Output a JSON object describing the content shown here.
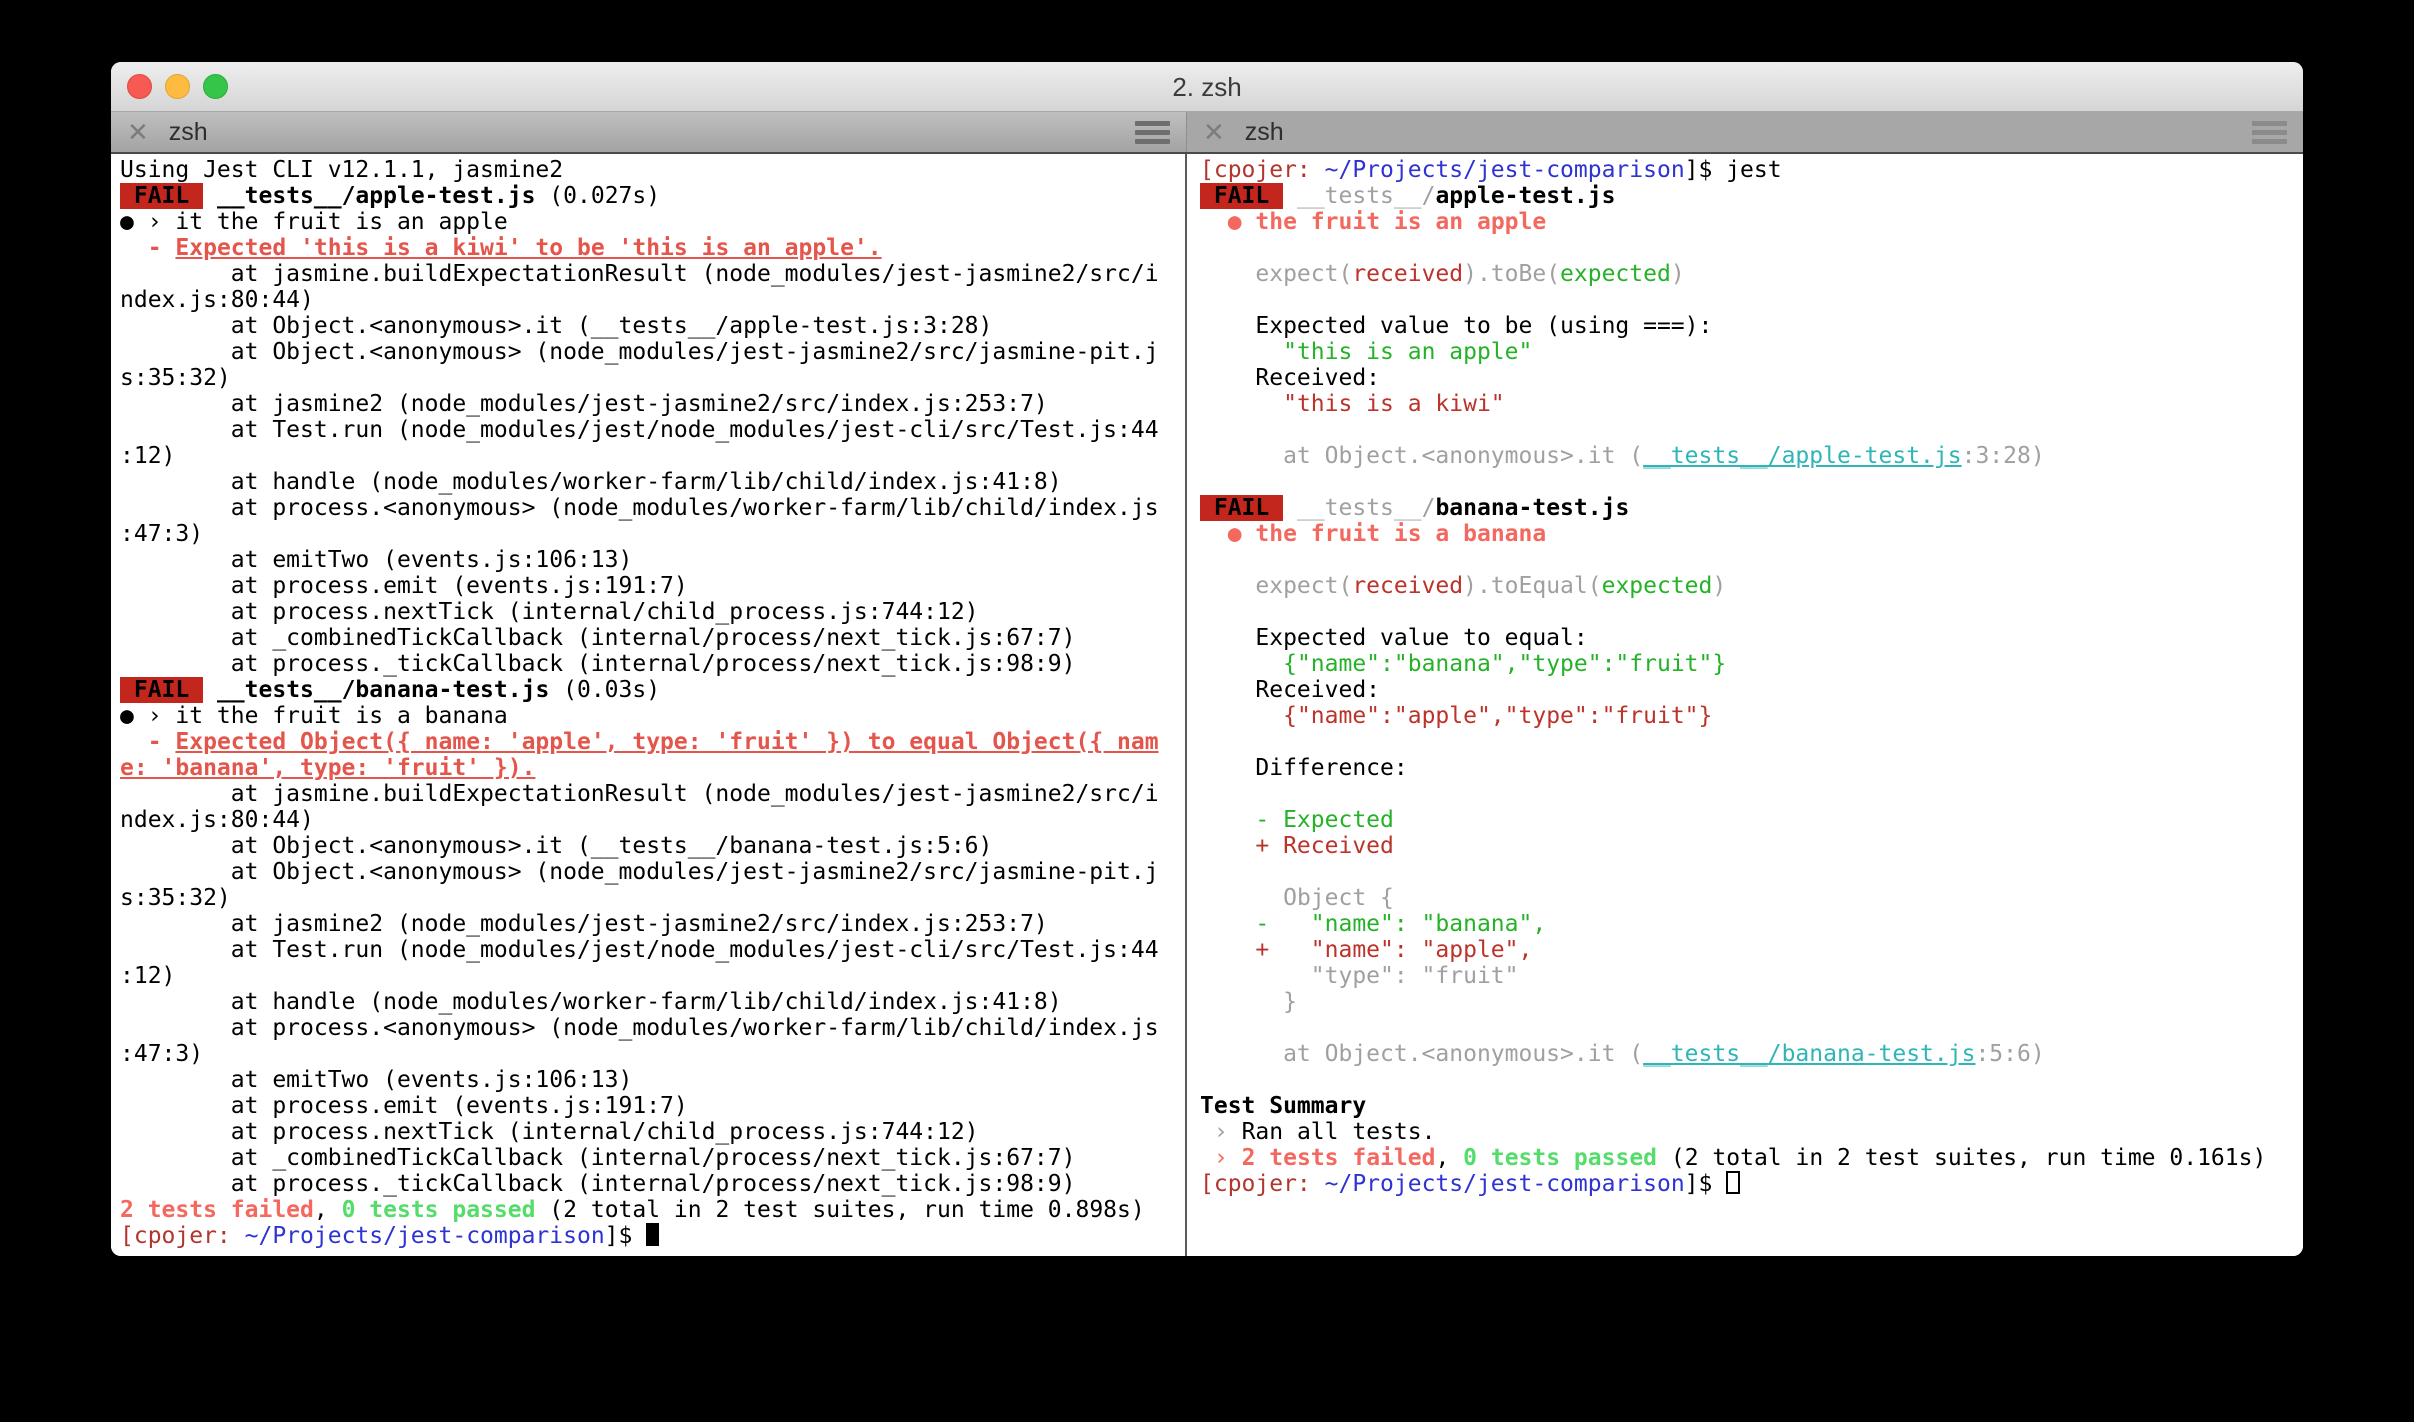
{
  "window": {
    "title": "2. zsh"
  },
  "tabs": {
    "close_icon": "✕",
    "left": {
      "label": "zsh"
    },
    "right": {
      "label": "zsh"
    }
  },
  "colors": {
    "fail_badge_bg": "#c3261c",
    "error_underline_red": "#e4564c",
    "salmon_red": "#f4695f",
    "brick_red": "#bb332a",
    "green": "#26b228",
    "light_green": "#55dc6b",
    "dim_gray": "#a0a0a0",
    "cyan_link": "#2fb5b7",
    "prompt_red": "#b0362e",
    "prompt_blue": "#2e33d1"
  },
  "left_pane": {
    "lines": [
      [
        {
          "t": "Using Jest CLI v12.1.1, jasmine2"
        }
      ],
      [
        {
          "t": " FAIL ",
          "c": "badge"
        },
        {
          "t": " "
        },
        {
          "t": "__tests__/apple-test.js",
          "c": "bold"
        },
        {
          "t": " (0.027s)"
        }
      ],
      [
        {
          "t": "● › it the fruit is an apple"
        }
      ],
      [
        {
          "t": "  "
        },
        {
          "t": "- ",
          "c": "errline"
        },
        {
          "t": "Expected 'this is a kiwi' to be 'this is an apple'.",
          "c": "errline u"
        }
      ],
      [
        {
          "t": "        at jasmine.buildExpectationResult (node_modules/jest-jasmine2/src/i"
        }
      ],
      [
        {
          "t": "ndex.js:80:44)"
        }
      ],
      [
        {
          "t": "        at Object.<anonymous>.it (__tests__/apple-test.js:3:28)"
        }
      ],
      [
        {
          "t": "        at Object.<anonymous> (node_modules/jest-jasmine2/src/jasmine-pit.j"
        }
      ],
      [
        {
          "t": "s:35:32)"
        }
      ],
      [
        {
          "t": "        at jasmine2 (node_modules/jest-jasmine2/src/index.js:253:7)"
        }
      ],
      [
        {
          "t": "        at Test.run (node_modules/jest/node_modules/jest-cli/src/Test.js:44"
        }
      ],
      [
        {
          "t": ":12)"
        }
      ],
      [
        {
          "t": "        at handle (node_modules/worker-farm/lib/child/index.js:41:8)"
        }
      ],
      [
        {
          "t": "        at process.<anonymous> (node_modules/worker-farm/lib/child/index.js"
        }
      ],
      [
        {
          "t": ":47:3)"
        }
      ],
      [
        {
          "t": "        at emitTwo (events.js:106:13)"
        }
      ],
      [
        {
          "t": "        at process.emit (events.js:191:7)"
        }
      ],
      [
        {
          "t": "        at process.nextTick (internal/child_process.js:744:12)"
        }
      ],
      [
        {
          "t": "        at _combinedTickCallback (internal/process/next_tick.js:67:7)"
        }
      ],
      [
        {
          "t": "        at process._tickCallback (internal/process/next_tick.js:98:9)"
        }
      ],
      [
        {
          "t": " FAIL ",
          "c": "badge"
        },
        {
          "t": " "
        },
        {
          "t": "__tests__/banana-test.js",
          "c": "bold"
        },
        {
          "t": " (0.03s)"
        }
      ],
      [
        {
          "t": "● › it the fruit is a banana"
        }
      ],
      [
        {
          "t": "  "
        },
        {
          "t": "- ",
          "c": "errline"
        },
        {
          "t": "Expected Object({ name: 'apple', type: 'fruit' }) to equal Object({ nam",
          "c": "errline u"
        }
      ],
      [
        {
          "t": "e: 'banana', type: 'fruit' }).",
          "c": "errline u"
        }
      ],
      [
        {
          "t": "        at jasmine.buildExpectationResult (node_modules/jest-jasmine2/src/i"
        }
      ],
      [
        {
          "t": "ndex.js:80:44)"
        }
      ],
      [
        {
          "t": "        at Object.<anonymous>.it (__tests__/banana-test.js:5:6)"
        }
      ],
      [
        {
          "t": "        at Object.<anonymous> (node_modules/jest-jasmine2/src/jasmine-pit.j"
        }
      ],
      [
        {
          "t": "s:35:32)"
        }
      ],
      [
        {
          "t": "        at jasmine2 (node_modules/jest-jasmine2/src/index.js:253:7)"
        }
      ],
      [
        {
          "t": "        at Test.run (node_modules/jest/node_modules/jest-cli/src/Test.js:44"
        }
      ],
      [
        {
          "t": ":12)"
        }
      ],
      [
        {
          "t": "        at handle (node_modules/worker-farm/lib/child/index.js:41:8)"
        }
      ],
      [
        {
          "t": "        at process.<anonymous> (node_modules/worker-farm/lib/child/index.js"
        }
      ],
      [
        {
          "t": ":47:3)"
        }
      ],
      [
        {
          "t": "        at emitTwo (events.js:106:13)"
        }
      ],
      [
        {
          "t": "        at process.emit (events.js:191:7)"
        }
      ],
      [
        {
          "t": "        at process.nextTick (internal/child_process.js:744:12)"
        }
      ],
      [
        {
          "t": "        at _combinedTickCallback (internal/process/next_tick.js:67:7)"
        }
      ],
      [
        {
          "t": "        at process._tickCallback (internal/process/next_tick.js:98:9)"
        }
      ],
      [
        {
          "t": "2 tests failed",
          "c": "salmon-b"
        },
        {
          "t": ", "
        },
        {
          "t": "0 tests passed",
          "c": "green-b"
        },
        {
          "t": " (2 total in 2 test suites, run time 0.898s)"
        }
      ],
      [
        {
          "t": "[cpojer:",
          "c": "prompt-red"
        },
        {
          "t": " "
        },
        {
          "t": "~/Projects/jest-comparison",
          "c": "blue"
        },
        {
          "t": "]$ "
        },
        {
          "t": "",
          "c": "cursor-solid"
        }
      ]
    ]
  },
  "right_pane": {
    "lines": [
      [
        {
          "t": "[cpojer:",
          "c": "prompt-red"
        },
        {
          "t": " "
        },
        {
          "t": "~/Projects/jest-comparison",
          "c": "blue"
        },
        {
          "t": "]$ jest"
        }
      ],
      [
        {
          "t": " FAIL ",
          "c": "badge"
        },
        {
          "t": " "
        },
        {
          "t": "__tests__/",
          "c": "dim"
        },
        {
          "t": "apple-test.js",
          "c": "bold"
        }
      ],
      [
        {
          "t": "  "
        },
        {
          "t": "●",
          "c": "salmon"
        },
        {
          "t": " "
        },
        {
          "t": "the fruit is an apple",
          "c": "salmon-b"
        }
      ],
      [],
      [
        {
          "t": "    "
        },
        {
          "t": "expect(",
          "c": "dim"
        },
        {
          "t": "received",
          "c": "brick"
        },
        {
          "t": ").toBe(",
          "c": "dim"
        },
        {
          "t": "expected",
          "c": "green"
        },
        {
          "t": ")",
          "c": "dim"
        }
      ],
      [],
      [
        {
          "t": "    Expected value to be (using ===):"
        }
      ],
      [
        {
          "t": "      "
        },
        {
          "t": "\"this is an apple\"",
          "c": "green"
        }
      ],
      [
        {
          "t": "    Received:"
        }
      ],
      [
        {
          "t": "      "
        },
        {
          "t": "\"this is a kiwi\"",
          "c": "brick"
        }
      ],
      [],
      [
        {
          "t": "      at Object.<anonymous>.it (",
          "c": "dim"
        },
        {
          "t": "__tests__/apple-test.js",
          "c": "cyan-u"
        },
        {
          "t": ":3:28)",
          "c": "dim"
        }
      ],
      [],
      [
        {
          "t": " FAIL ",
          "c": "badge"
        },
        {
          "t": " "
        },
        {
          "t": "__tests__/",
          "c": "dim"
        },
        {
          "t": "banana-test.js",
          "c": "bold"
        }
      ],
      [
        {
          "t": "  "
        },
        {
          "t": "●",
          "c": "salmon"
        },
        {
          "t": " "
        },
        {
          "t": "the fruit is a banana",
          "c": "salmon-b"
        }
      ],
      [],
      [
        {
          "t": "    "
        },
        {
          "t": "expect(",
          "c": "dim"
        },
        {
          "t": "received",
          "c": "brick"
        },
        {
          "t": ").toEqual(",
          "c": "dim"
        },
        {
          "t": "expected",
          "c": "green"
        },
        {
          "t": ")",
          "c": "dim"
        }
      ],
      [],
      [
        {
          "t": "    Expected value to equal:"
        }
      ],
      [
        {
          "t": "      "
        },
        {
          "t": "{\"name\":\"banana\",\"type\":\"fruit\"}",
          "c": "green"
        }
      ],
      [
        {
          "t": "    Received:"
        }
      ],
      [
        {
          "t": "      "
        },
        {
          "t": "{\"name\":\"apple\",\"type\":\"fruit\"}",
          "c": "brick"
        }
      ],
      [],
      [
        {
          "t": "    Difference:"
        }
      ],
      [],
      [
        {
          "t": "    "
        },
        {
          "t": "- Expected",
          "c": "green"
        }
      ],
      [
        {
          "t": "    "
        },
        {
          "t": "+ Received",
          "c": "brick"
        }
      ],
      [],
      [
        {
          "t": "      "
        },
        {
          "t": "Object {",
          "c": "dim"
        }
      ],
      [
        {
          "t": "    "
        },
        {
          "t": "-   \"name\": \"banana\",",
          "c": "green"
        }
      ],
      [
        {
          "t": "    "
        },
        {
          "t": "+   \"name\": \"apple\",",
          "c": "brick"
        }
      ],
      [
        {
          "t": "        \"type\": \"fruit\"",
          "c": "dim"
        }
      ],
      [
        {
          "t": "      }",
          "c": "dim"
        }
      ],
      [],
      [
        {
          "t": "      at Object.<anonymous>.it (",
          "c": "dim"
        },
        {
          "t": "__tests__/banana-test.js",
          "c": "cyan-u"
        },
        {
          "t": ":5:6)",
          "c": "dim"
        }
      ],
      [],
      [
        {
          "t": "Test Summary",
          "c": "bold"
        }
      ],
      [
        {
          "t": " "
        },
        {
          "t": "›",
          "c": "dim"
        },
        {
          "t": " Ran all tests."
        }
      ],
      [
        {
          "t": " "
        },
        {
          "t": "›",
          "c": "salmon"
        },
        {
          "t": " "
        },
        {
          "t": "2 tests failed",
          "c": "salmon-b"
        },
        {
          "t": ", "
        },
        {
          "t": "0 tests passed",
          "c": "green-b"
        },
        {
          "t": " (2 total in 2 test suites, run time 0.161s)"
        }
      ],
      [
        {
          "t": "[cpojer:",
          "c": "prompt-red"
        },
        {
          "t": " "
        },
        {
          "t": "~/Projects/jest-comparison",
          "c": "blue"
        },
        {
          "t": "]$ "
        },
        {
          "t": "",
          "c": "cursor-hollow"
        }
      ]
    ]
  }
}
